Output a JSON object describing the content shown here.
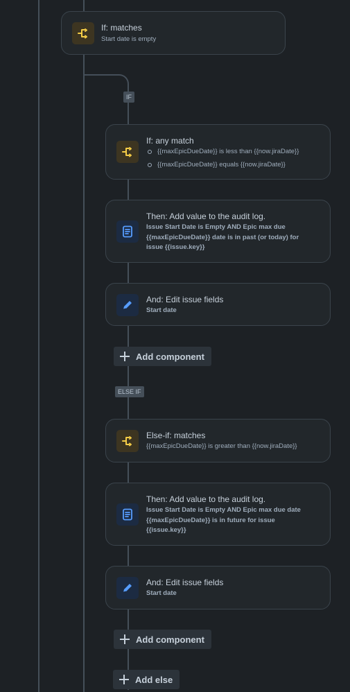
{
  "colors": {
    "background": "#1d2125",
    "card": "#22272b",
    "condition_icon": "#f5cd47",
    "action_icon": "#579dff",
    "connector": "#454f59"
  },
  "top_condition": {
    "title": "If: matches",
    "subtitle": "Start date is empty",
    "icon": "branch-icon"
  },
  "if_tag": "IF",
  "if_any": {
    "title": "If: any match",
    "conditions": [
      "{{maxEpicDueDate}} is less than {{now.jiraDate}}",
      "{{maxEpicDueDate}} equals {{now.jiraDate}}"
    ],
    "icon": "branch-icon"
  },
  "audit_1": {
    "title": "Then: Add value to the audit log.",
    "lines": [
      "Issue Start Date is Empty AND Epic max due",
      "{{maxEpicDueDate}} date is in past (or today) for",
      "issue {{issue.key}}"
    ],
    "icon": "document-icon"
  },
  "edit_1": {
    "title": "And: Edit issue fields",
    "subtitle": "Start date",
    "icon": "pencil-icon"
  },
  "add_component_1": "Add component",
  "else_if_tag": "ELSE IF",
  "else_if": {
    "title": "Else-if: matches",
    "subtitle": "{{maxEpicDueDate}} is greater than {{now.jiraDate}}",
    "icon": "branch-icon"
  },
  "audit_2": {
    "title": "Then: Add value to the audit log.",
    "lines": [
      "Issue Start Date is Empty AND Epic max due date",
      "{{maxEpicDueDate}} is in future for issue",
      "{{issue.key}}"
    ],
    "icon": "document-icon"
  },
  "edit_2": {
    "title": "And: Edit issue fields",
    "subtitle": "Start date",
    "icon": "pencil-icon"
  },
  "add_component_2": "Add component",
  "add_else": "Add else"
}
